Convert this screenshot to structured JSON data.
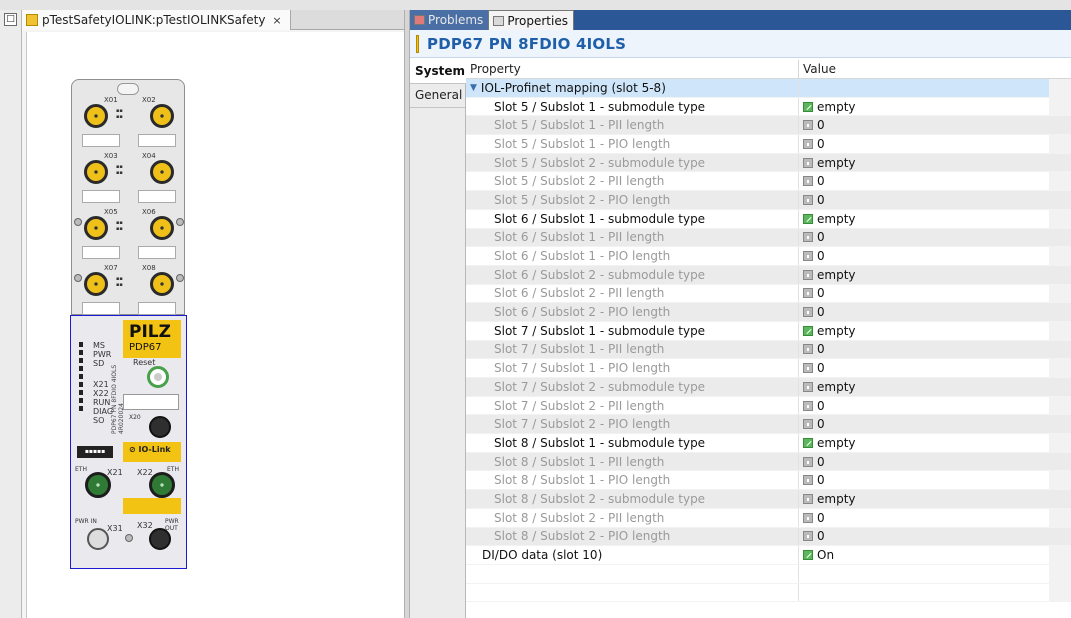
{
  "editor": {
    "tab_title": "pTestSafetyIOLINK:pTestIOLINKSafety",
    "close": "×"
  },
  "device": {
    "brand": "PILZ",
    "model": "PDP67",
    "reset": "Reset",
    "status_leds": [
      "MS",
      "PWR",
      "SD",
      "",
      "X21",
      "X22",
      "RUN",
      "DIAG",
      "SO"
    ],
    "vertical_label": "PDP67 PN 8FDIO 4IOLS",
    "vertical_number": "4R020024",
    "iolink": "IO-Link",
    "ports_top": [
      "X01",
      "X02",
      "X03",
      "X04",
      "X05",
      "X06",
      "X07",
      "X08"
    ],
    "port_x20": "X20",
    "port_x21": "X21",
    "port_x22": "X22",
    "port_x31": "X31",
    "port_x32": "X32",
    "eth": "ETH",
    "pwr_in": "PWR IN",
    "pwr_out": "PWR OUT"
  },
  "props_view": {
    "tab_problems": "Problems",
    "tab_properties": "Properties",
    "title": "PDP67 PN 8FDIO 4IOLS",
    "side_tabs": [
      "System",
      "General"
    ],
    "col_property": "Property",
    "col_value": "Value",
    "rows": [
      {
        "label": "IOL-Profinet mapping (slot 5-8)",
        "value": "",
        "kind": "group",
        "icon": ""
      },
      {
        "label": "Slot 5 / Subslot 1 - submodule type",
        "value": "empty",
        "kind": "en",
        "icon": "edit"
      },
      {
        "label": "Slot 5 / Subslot 1 - PII length",
        "value": "0",
        "kind": "dis",
        "icon": "lock"
      },
      {
        "label": "Slot 5 / Subslot 1 - PIO length",
        "value": "0",
        "kind": "dis",
        "icon": "lock"
      },
      {
        "label": "Slot 5 / Subslot 2 - submodule type",
        "value": "empty",
        "kind": "dis",
        "icon": "lock"
      },
      {
        "label": "Slot 5 / Subslot 2 - PII length",
        "value": "0",
        "kind": "dis",
        "icon": "lock"
      },
      {
        "label": "Slot 5 / Subslot 2 - PIO length",
        "value": "0",
        "kind": "dis",
        "icon": "lock"
      },
      {
        "label": "Slot 6 / Subslot 1 - submodule type",
        "value": "empty",
        "kind": "en",
        "icon": "edit"
      },
      {
        "label": "Slot 6 / Subslot 1 - PII length",
        "value": "0",
        "kind": "dis",
        "icon": "lock"
      },
      {
        "label": "Slot 6 / Subslot 1 - PIO length",
        "value": "0",
        "kind": "dis",
        "icon": "lock"
      },
      {
        "label": "Slot 6 / Subslot 2 - submodule type",
        "value": "empty",
        "kind": "dis",
        "icon": "lock"
      },
      {
        "label": "Slot 6 / Subslot 2 - PII length",
        "value": "0",
        "kind": "dis",
        "icon": "lock"
      },
      {
        "label": "Slot 6 / Subslot 2 - PIO length",
        "value": "0",
        "kind": "dis",
        "icon": "lock"
      },
      {
        "label": "Slot 7 / Subslot 1 - submodule type",
        "value": "empty",
        "kind": "en",
        "icon": "edit"
      },
      {
        "label": "Slot 7 / Subslot 1 - PII length",
        "value": "0",
        "kind": "dis",
        "icon": "lock"
      },
      {
        "label": "Slot 7 / Subslot 1 - PIO length",
        "value": "0",
        "kind": "dis",
        "icon": "lock"
      },
      {
        "label": "Slot 7 / Subslot 2 - submodule type",
        "value": "empty",
        "kind": "dis",
        "icon": "lock"
      },
      {
        "label": "Slot 7 / Subslot 2 - PII length",
        "value": "0",
        "kind": "dis",
        "icon": "lock"
      },
      {
        "label": "Slot 7 / Subslot 2 - PIO length",
        "value": "0",
        "kind": "dis",
        "icon": "lock"
      },
      {
        "label": "Slot 8 / Subslot 1 - submodule type",
        "value": "empty",
        "kind": "en",
        "icon": "edit"
      },
      {
        "label": "Slot 8 / Subslot 1 - PII length",
        "value": "0",
        "kind": "dis",
        "icon": "lock"
      },
      {
        "label": "Slot 8 / Subslot 1 - PIO length",
        "value": "0",
        "kind": "dis",
        "icon": "lock"
      },
      {
        "label": "Slot 8 / Subslot 2 - submodule type",
        "value": "empty",
        "kind": "dis",
        "icon": "lock"
      },
      {
        "label": "Slot 8 / Subslot 2 - PII length",
        "value": "0",
        "kind": "dis",
        "icon": "lock"
      },
      {
        "label": "Slot 8 / Subslot 2 - PIO length",
        "value": "0",
        "kind": "dis",
        "icon": "lock"
      },
      {
        "label": "DI/DO data (slot 10)",
        "value": "On",
        "kind": "top",
        "icon": "edit"
      },
      {
        "label": "",
        "value": "",
        "kind": "blank",
        "icon": ""
      },
      {
        "label": "",
        "value": "",
        "kind": "blank",
        "icon": ""
      }
    ]
  }
}
